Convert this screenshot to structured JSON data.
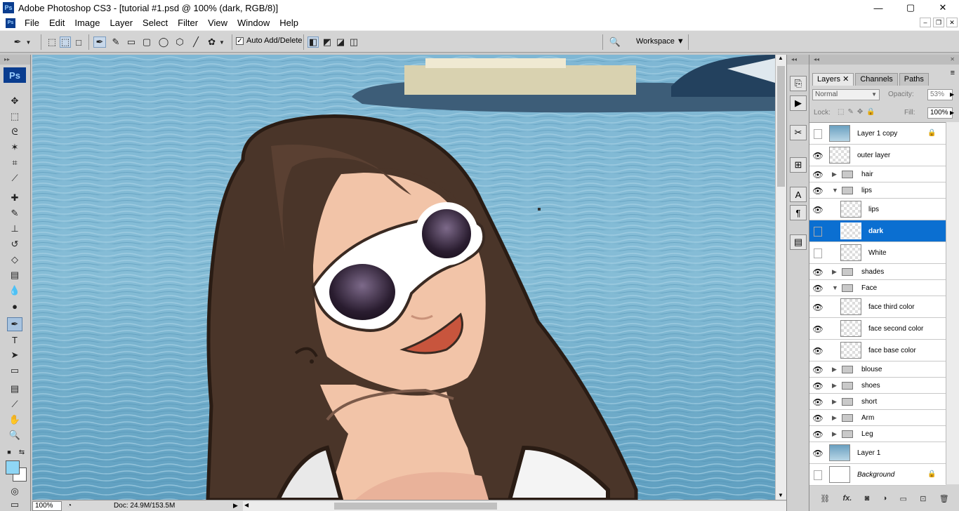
{
  "window": {
    "app_icon": "Ps",
    "title": "Adobe Photoshop CS3 - [tutorial #1.psd @ 100% (dark, RGB/8)]",
    "minimize": "—",
    "maximize": "▢",
    "close": "✕"
  },
  "menu": {
    "ps_icon": "Ps",
    "items": [
      "File",
      "Edit",
      "Image",
      "Layer",
      "Select",
      "Filter",
      "View",
      "Window",
      "Help"
    ],
    "doc_minimize": "–",
    "doc_restore": "❐",
    "doc_close": "✕"
  },
  "options": {
    "auto_add_delete": "Auto Add/Delete",
    "auto_add_checked": true,
    "workspace": "Workspace ▼"
  },
  "tools": {
    "logo": "Ps"
  },
  "colors": {
    "foreground": "#8fd6f5",
    "background": "#ffffff",
    "selection": "#0b6fd1"
  },
  "status": {
    "zoom": "100%",
    "doc": "Doc: 24.9M/153.5M"
  },
  "layers_panel": {
    "tabs": [
      {
        "label": "Layers",
        "close": "✕"
      },
      {
        "label": "Channels"
      },
      {
        "label": "Paths"
      }
    ],
    "blend_mode": "Normal",
    "opacity_label": "Opacity:",
    "opacity": "53%",
    "lock_label": "Lock:",
    "fill_label": "Fill:",
    "fill": "100%",
    "layers": [
      {
        "name": "Layer 1 copy",
        "visible": false,
        "type": "photo",
        "locked": true
      },
      {
        "name": "outer layer",
        "visible": true,
        "type": "layer"
      },
      {
        "name": "hair",
        "visible": true,
        "type": "group",
        "expanded": false
      },
      {
        "name": "lips",
        "visible": true,
        "type": "group",
        "expanded": true
      },
      {
        "name": "lips",
        "visible": true,
        "type": "layer",
        "indent": true
      },
      {
        "name": "dark",
        "visible": false,
        "type": "layer",
        "indent": true,
        "selected": true
      },
      {
        "name": "White",
        "visible": false,
        "type": "layer",
        "indent": true
      },
      {
        "name": "shades",
        "visible": true,
        "type": "group",
        "expanded": false
      },
      {
        "name": "Face",
        "visible": true,
        "type": "group",
        "expanded": true
      },
      {
        "name": "face third color",
        "visible": true,
        "type": "layer",
        "indent": true
      },
      {
        "name": "face second color",
        "visible": true,
        "type": "layer",
        "indent": true
      },
      {
        "name": "face base color",
        "visible": true,
        "type": "layer",
        "indent": true
      },
      {
        "name": "blouse",
        "visible": true,
        "type": "group",
        "expanded": false
      },
      {
        "name": "shoes",
        "visible": true,
        "type": "group",
        "expanded": false
      },
      {
        "name": "short",
        "visible": true,
        "type": "group",
        "expanded": false
      },
      {
        "name": "Arm",
        "visible": true,
        "type": "group",
        "expanded": false
      },
      {
        "name": "Leg",
        "visible": true,
        "type": "group",
        "expanded": false
      },
      {
        "name": "Layer 1",
        "visible": true,
        "type": "photo"
      },
      {
        "name": "Background",
        "visible": false,
        "type": "background",
        "locked": true
      }
    ]
  }
}
